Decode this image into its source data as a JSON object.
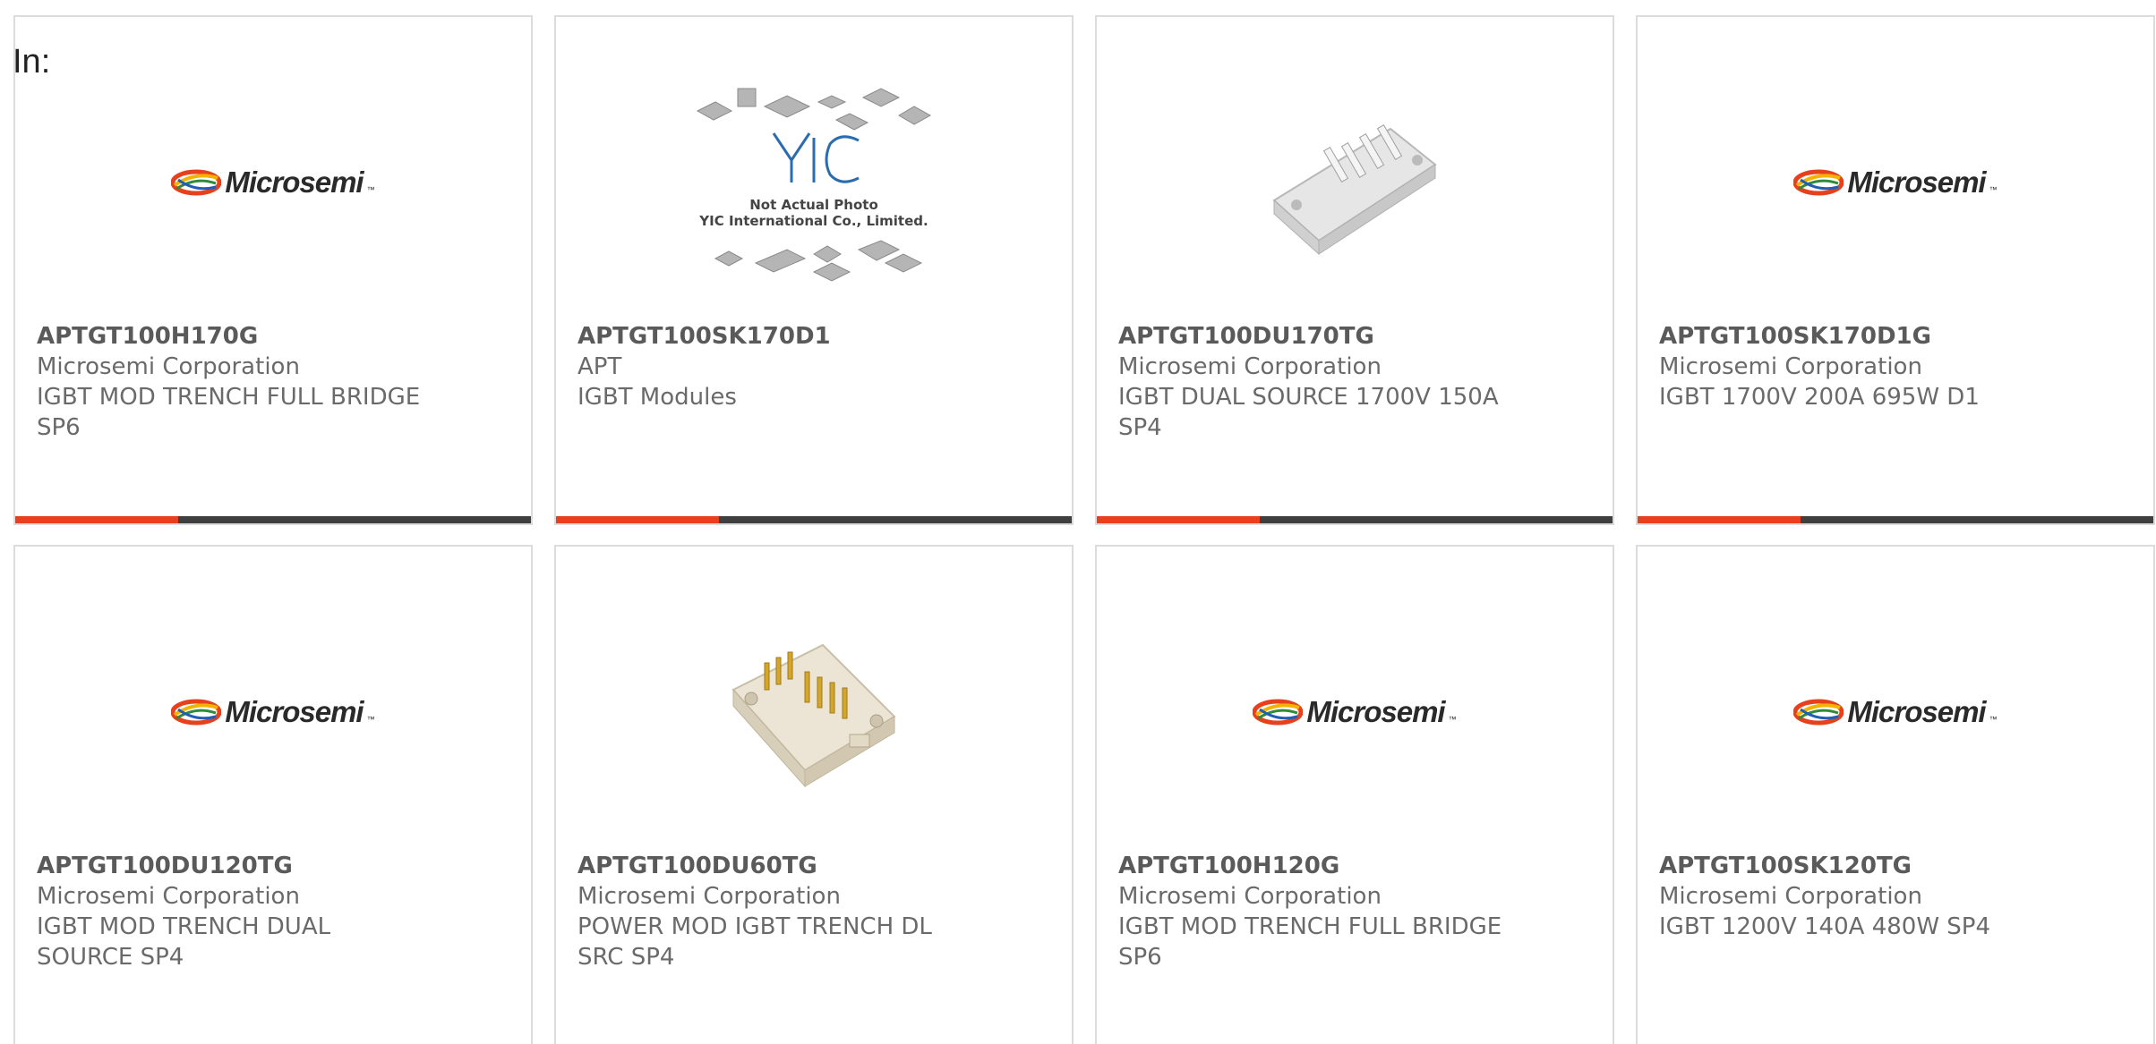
{
  "header": {
    "label": "In:"
  },
  "colors": {
    "accent": "#e8401c",
    "bar": "#3f3f3f",
    "border": "#dcdcdc",
    "text": "#6a6a6a"
  },
  "logo_text": {
    "microsemi": "Microsemi",
    "microsemi_tm": "™"
  },
  "yic": {
    "line1": "Not Actual Photo",
    "line2": "YIC International Co., Limited."
  },
  "products": [
    {
      "part_number": "APTGT100H170G",
      "manufacturer": "Microsemi Corporation",
      "description": "IGBT MOD TRENCH FULL BRIDGE SP6",
      "image": "microsemi-logo"
    },
    {
      "part_number": "APTGT100SK170D1",
      "manufacturer": "APT",
      "description": "IGBT Modules",
      "image": "yic-placeholder"
    },
    {
      "part_number": "APTGT100DU170TG",
      "manufacturer": "Microsemi Corporation",
      "description": "IGBT DUAL SOURCE 1700V 150A SP4",
      "image": "module-photo-grey"
    },
    {
      "part_number": "APTGT100SK170D1G",
      "manufacturer": "Microsemi Corporation",
      "description": "IGBT 1700V 200A 695W D1",
      "image": "microsemi-logo"
    },
    {
      "part_number": "APTGT100DU120TG",
      "manufacturer": "Microsemi Corporation",
      "description": "IGBT MOD TRENCH DUAL SOURCE SP4",
      "image": "microsemi-logo"
    },
    {
      "part_number": "APTGT100DU60TG",
      "manufacturer": "Microsemi Corporation",
      "description": "POWER MOD IGBT TRENCH DL SRC SP4",
      "image": "module-photo-beige"
    },
    {
      "part_number": "APTGT100H120G",
      "manufacturer": "Microsemi Corporation",
      "description": "IGBT MOD TRENCH FULL BRIDGE SP6",
      "image": "microsemi-logo"
    },
    {
      "part_number": "APTGT100SK120TG",
      "manufacturer": "Microsemi Corporation",
      "description": "IGBT 1200V 140A 480W SP4",
      "image": "microsemi-logo"
    }
  ]
}
